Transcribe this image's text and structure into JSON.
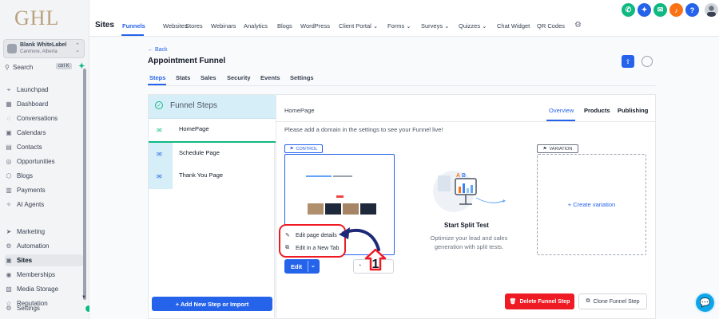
{
  "brand": {
    "logo": "GHL"
  },
  "account": {
    "name": "Blank WhiteLabel",
    "location": "Canmore, Alberta"
  },
  "search": {
    "label": "Search",
    "shortcut": "ctrl K"
  },
  "sidebar": {
    "items": [
      {
        "label": "Launchpad",
        "icon": "rocket-icon"
      },
      {
        "label": "Dashboard",
        "icon": "dashboard-icon"
      },
      {
        "label": "Conversations",
        "icon": "chat-icon"
      },
      {
        "label": "Calendars",
        "icon": "calendar-icon"
      },
      {
        "label": "Contacts",
        "icon": "contacts-icon"
      },
      {
        "label": "Opportunities",
        "icon": "target-icon"
      },
      {
        "label": "Blogs",
        "icon": "blog-icon"
      },
      {
        "label": "Payments",
        "icon": "payments-icon"
      },
      {
        "label": "AI Agents",
        "icon": "ai-icon"
      },
      {
        "label": "Marketing",
        "icon": "marketing-icon"
      },
      {
        "label": "Automation",
        "icon": "automation-icon"
      },
      {
        "label": "Sites",
        "icon": "sites-icon",
        "active": true
      },
      {
        "label": "Memberships",
        "icon": "memberships-icon"
      },
      {
        "label": "Media Storage",
        "icon": "media-icon"
      },
      {
        "label": "Reputation",
        "icon": "reputation-icon"
      },
      {
        "label": "Settings",
        "icon": "settings-icon"
      }
    ]
  },
  "topbar": {
    "title": "Sites",
    "tabs": [
      {
        "label": "Funnels",
        "active": true
      },
      {
        "label": "Websites"
      },
      {
        "label": "Stores"
      },
      {
        "label": "Webinars"
      },
      {
        "label": "Analytics"
      },
      {
        "label": "Blogs"
      },
      {
        "label": "WordPress"
      },
      {
        "label": "Client Portal ⌄"
      },
      {
        "label": "Forms ⌄"
      },
      {
        "label": "Surveys ⌄"
      },
      {
        "label": "Quizzes ⌄"
      },
      {
        "label": "Chat Widget"
      },
      {
        "label": "QR Codes"
      }
    ],
    "header_buttons": [
      {
        "icon": "phone-icon",
        "color": "#10b981",
        "glyph": "✆"
      },
      {
        "icon": "magic-icon",
        "color": "#2563eb",
        "glyph": "✦"
      },
      {
        "icon": "megaphone-icon",
        "color": "#10b981",
        "glyph": "✉"
      },
      {
        "icon": "bell-icon",
        "color": "#f97316",
        "glyph": "♪"
      },
      {
        "icon": "help-icon",
        "color": "#2563eb",
        "glyph": "?"
      }
    ]
  },
  "funnel": {
    "back": "← Back",
    "title": "Appointment Funnel",
    "tabs": [
      {
        "label": "Steps",
        "active": true
      },
      {
        "label": "Stats"
      },
      {
        "label": "Sales"
      },
      {
        "label": "Security"
      },
      {
        "label": "Events"
      },
      {
        "label": "Settings"
      }
    ]
  },
  "steps": {
    "heading": "Funnel Steps",
    "items": [
      {
        "label": "HomePage",
        "active": true
      },
      {
        "label": "Schedule Page"
      },
      {
        "label": "Thank You Page"
      }
    ],
    "add_button": "+ Add New Step or Import"
  },
  "page": {
    "name": "HomePage",
    "tabs": [
      {
        "label": "Overview",
        "active": true
      },
      {
        "label": "Products"
      },
      {
        "label": "Publishing"
      }
    ],
    "domain_message": "Please add a domain in the settings to see your Funnel live!",
    "control_label": "CONTROL",
    "variation_label": "VARIATION",
    "create_variation": "+ Create variation",
    "edit_button": "Edit",
    "dropdown": [
      {
        "label": "Edit page details",
        "icon": "pencil-icon"
      },
      {
        "label": "Edit in a New Tab",
        "icon": "external-edit-icon"
      }
    ],
    "split_test": {
      "title": "Start Split Test",
      "line1": "Optimize your lead and sales",
      "line2": "generation with split tests."
    },
    "delete_button": "Delete Funnel Step",
    "clone_button": "Clone Funnel Step"
  },
  "annotation": {
    "number": "1"
  },
  "colors": {
    "accent": "#2563eb",
    "danger": "#ef1b24",
    "success": "#10b981"
  }
}
